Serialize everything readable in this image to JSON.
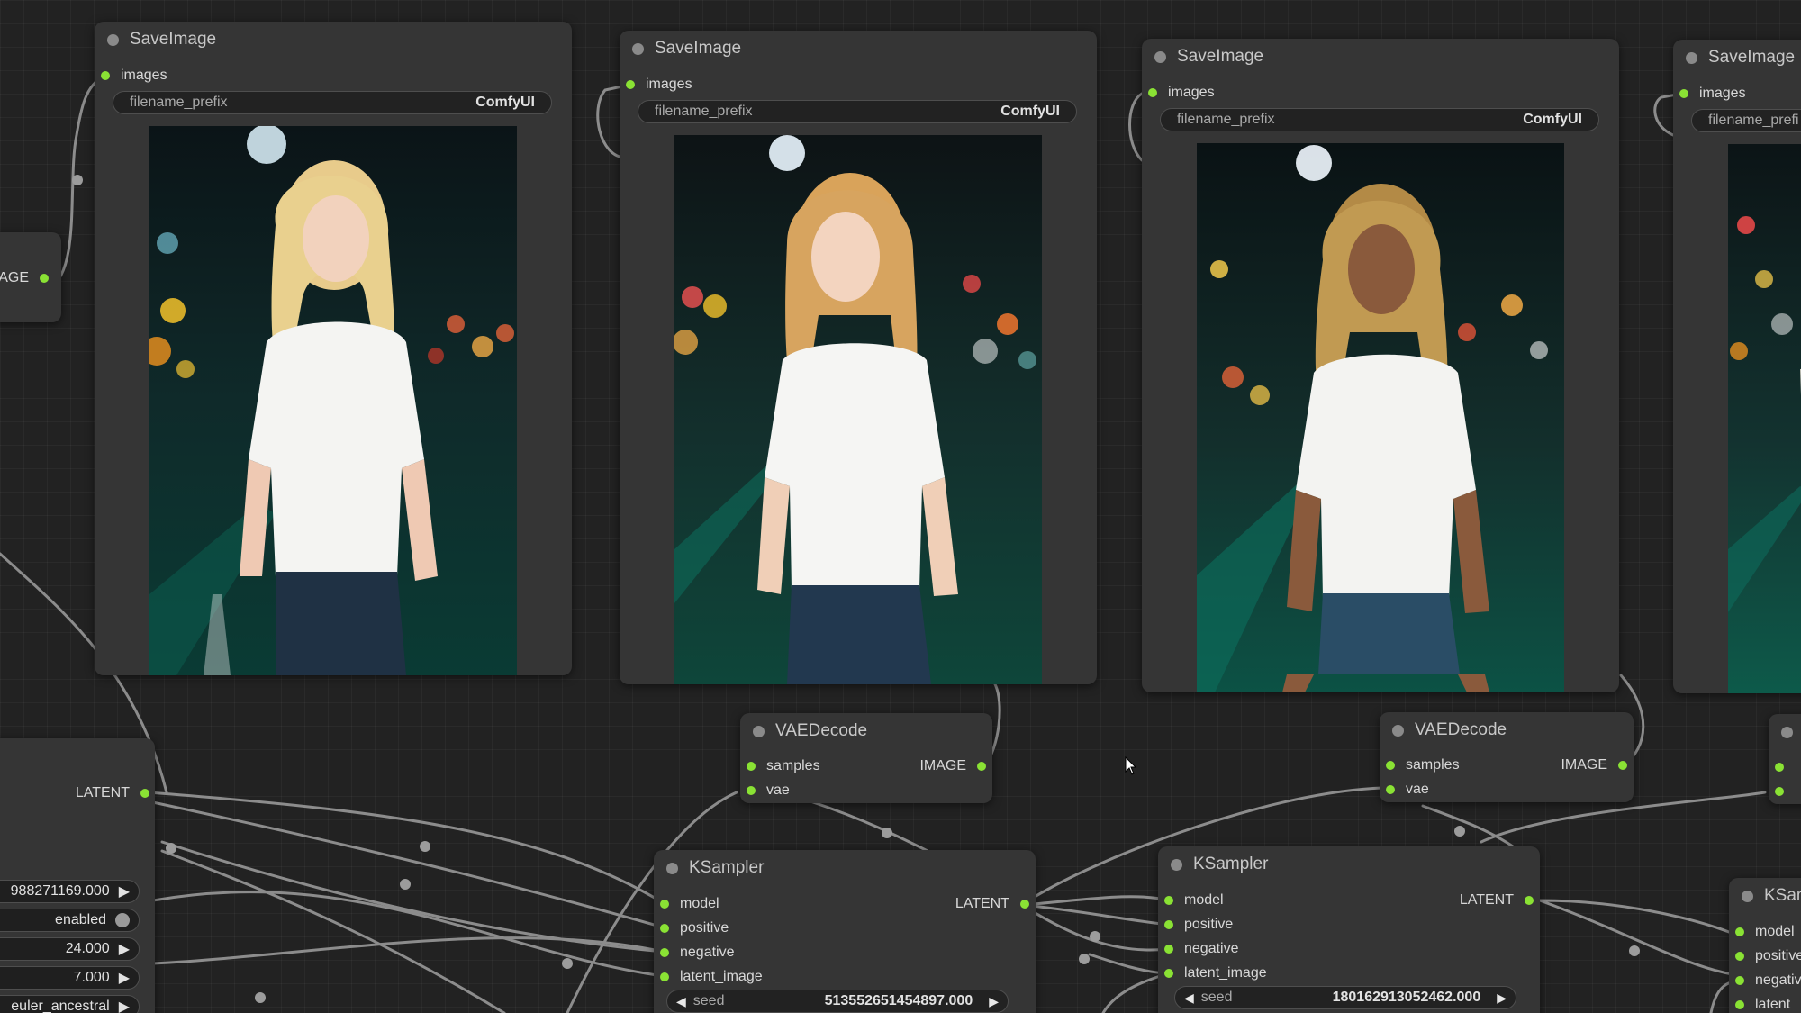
{
  "save_nodes": [
    {
      "title": "SaveImage",
      "input_label": "images",
      "widget_label": "filename_prefix",
      "widget_value": "ComfyUI",
      "output_label": "IMAGE"
    },
    {
      "title": "SaveImage",
      "input_label": "images",
      "widget_label": "filename_prefix",
      "widget_value": "ComfyUI"
    },
    {
      "title": "SaveImage",
      "input_label": "images",
      "widget_label": "filename_prefix",
      "widget_value": "ComfyUI"
    },
    {
      "title": "SaveImage",
      "input_label": "images",
      "widget_label": "filename_prefi"
    }
  ],
  "left_partial": {
    "image_output": "IMAGE",
    "latent_output": "LATENT",
    "seed_value": "988271169.000",
    "toggle_label": "enabled",
    "steps_value": "24.000",
    "cfg_value": "7.000",
    "sampler_value": "euler_ancestral"
  },
  "vae_nodes": [
    {
      "title": "VAEDecode",
      "input_samples": "samples",
      "input_vae": "vae",
      "output": "IMAGE"
    },
    {
      "title": "VAEDecode",
      "input_samples": "samples",
      "input_vae": "vae",
      "output": "IMAGE"
    }
  ],
  "ksampler_nodes": [
    {
      "title": "KSampler",
      "inputs": [
        "model",
        "positive",
        "negative",
        "latent_image"
      ],
      "output": "LATENT",
      "seed_label": "seed",
      "seed_value": "513552651454897.000"
    },
    {
      "title": "KSampler",
      "inputs": [
        "model",
        "positive",
        "negative",
        "latent_image"
      ],
      "output": "LATENT",
      "seed_label": "seed",
      "seed_value": "180162913052462.000"
    },
    {
      "title": "KSam",
      "inputs": [
        "model",
        "positive",
        "negativ",
        "latent"
      ]
    }
  ],
  "colors": {
    "canvas": "#222222",
    "node": "#353535",
    "slot_connected": "#8ae234",
    "link": "#9a9a9a"
  }
}
